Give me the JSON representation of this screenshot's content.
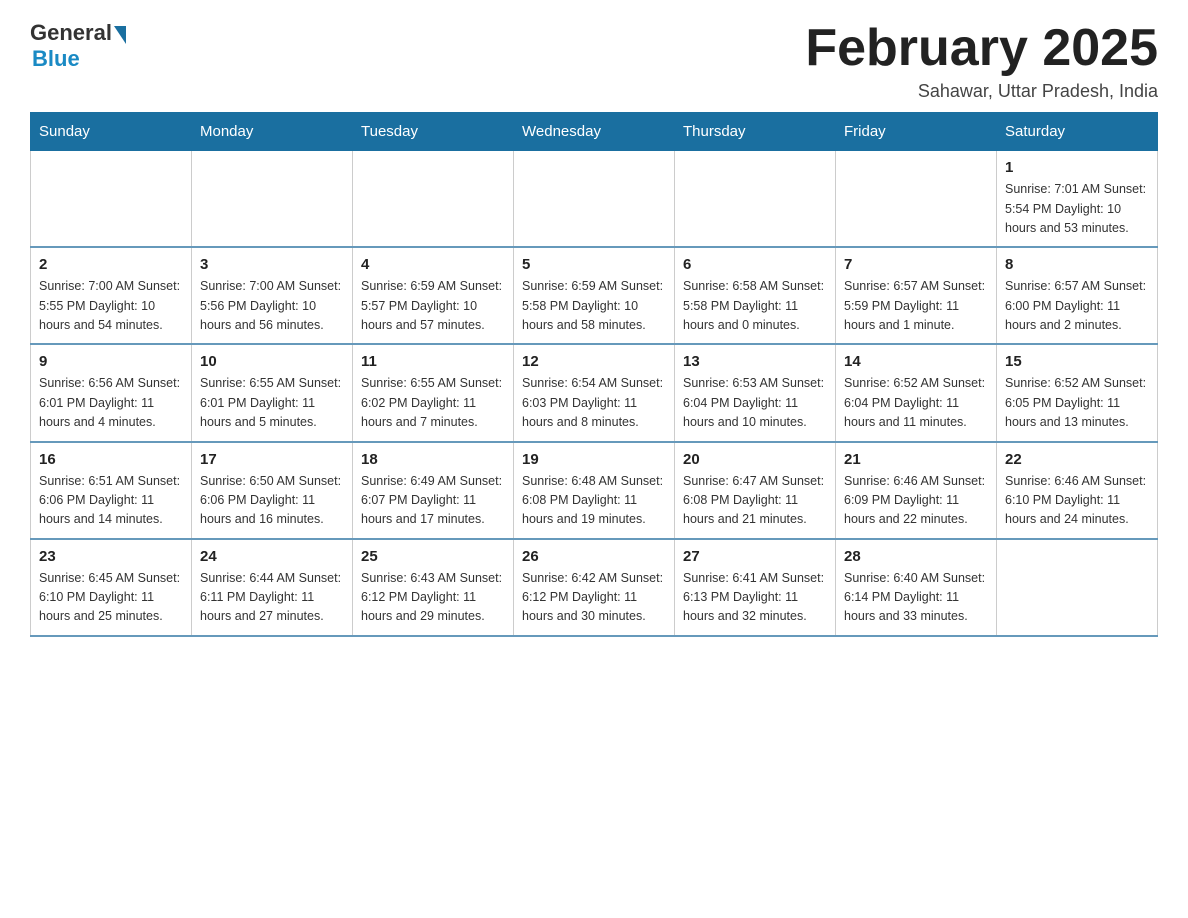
{
  "header": {
    "logo_general": "General",
    "logo_blue": "Blue",
    "month_title": "February 2025",
    "location": "Sahawar, Uttar Pradesh, India"
  },
  "days_of_week": [
    "Sunday",
    "Monday",
    "Tuesday",
    "Wednesday",
    "Thursday",
    "Friday",
    "Saturday"
  ],
  "weeks": [
    [
      {
        "day": "",
        "info": ""
      },
      {
        "day": "",
        "info": ""
      },
      {
        "day": "",
        "info": ""
      },
      {
        "day": "",
        "info": ""
      },
      {
        "day": "",
        "info": ""
      },
      {
        "day": "",
        "info": ""
      },
      {
        "day": "1",
        "info": "Sunrise: 7:01 AM\nSunset: 5:54 PM\nDaylight: 10 hours and 53 minutes."
      }
    ],
    [
      {
        "day": "2",
        "info": "Sunrise: 7:00 AM\nSunset: 5:55 PM\nDaylight: 10 hours and 54 minutes."
      },
      {
        "day": "3",
        "info": "Sunrise: 7:00 AM\nSunset: 5:56 PM\nDaylight: 10 hours and 56 minutes."
      },
      {
        "day": "4",
        "info": "Sunrise: 6:59 AM\nSunset: 5:57 PM\nDaylight: 10 hours and 57 minutes."
      },
      {
        "day": "5",
        "info": "Sunrise: 6:59 AM\nSunset: 5:58 PM\nDaylight: 10 hours and 58 minutes."
      },
      {
        "day": "6",
        "info": "Sunrise: 6:58 AM\nSunset: 5:58 PM\nDaylight: 11 hours and 0 minutes."
      },
      {
        "day": "7",
        "info": "Sunrise: 6:57 AM\nSunset: 5:59 PM\nDaylight: 11 hours and 1 minute."
      },
      {
        "day": "8",
        "info": "Sunrise: 6:57 AM\nSunset: 6:00 PM\nDaylight: 11 hours and 2 minutes."
      }
    ],
    [
      {
        "day": "9",
        "info": "Sunrise: 6:56 AM\nSunset: 6:01 PM\nDaylight: 11 hours and 4 minutes."
      },
      {
        "day": "10",
        "info": "Sunrise: 6:55 AM\nSunset: 6:01 PM\nDaylight: 11 hours and 5 minutes."
      },
      {
        "day": "11",
        "info": "Sunrise: 6:55 AM\nSunset: 6:02 PM\nDaylight: 11 hours and 7 minutes."
      },
      {
        "day": "12",
        "info": "Sunrise: 6:54 AM\nSunset: 6:03 PM\nDaylight: 11 hours and 8 minutes."
      },
      {
        "day": "13",
        "info": "Sunrise: 6:53 AM\nSunset: 6:04 PM\nDaylight: 11 hours and 10 minutes."
      },
      {
        "day": "14",
        "info": "Sunrise: 6:52 AM\nSunset: 6:04 PM\nDaylight: 11 hours and 11 minutes."
      },
      {
        "day": "15",
        "info": "Sunrise: 6:52 AM\nSunset: 6:05 PM\nDaylight: 11 hours and 13 minutes."
      }
    ],
    [
      {
        "day": "16",
        "info": "Sunrise: 6:51 AM\nSunset: 6:06 PM\nDaylight: 11 hours and 14 minutes."
      },
      {
        "day": "17",
        "info": "Sunrise: 6:50 AM\nSunset: 6:06 PM\nDaylight: 11 hours and 16 minutes."
      },
      {
        "day": "18",
        "info": "Sunrise: 6:49 AM\nSunset: 6:07 PM\nDaylight: 11 hours and 17 minutes."
      },
      {
        "day": "19",
        "info": "Sunrise: 6:48 AM\nSunset: 6:08 PM\nDaylight: 11 hours and 19 minutes."
      },
      {
        "day": "20",
        "info": "Sunrise: 6:47 AM\nSunset: 6:08 PM\nDaylight: 11 hours and 21 minutes."
      },
      {
        "day": "21",
        "info": "Sunrise: 6:46 AM\nSunset: 6:09 PM\nDaylight: 11 hours and 22 minutes."
      },
      {
        "day": "22",
        "info": "Sunrise: 6:46 AM\nSunset: 6:10 PM\nDaylight: 11 hours and 24 minutes."
      }
    ],
    [
      {
        "day": "23",
        "info": "Sunrise: 6:45 AM\nSunset: 6:10 PM\nDaylight: 11 hours and 25 minutes."
      },
      {
        "day": "24",
        "info": "Sunrise: 6:44 AM\nSunset: 6:11 PM\nDaylight: 11 hours and 27 minutes."
      },
      {
        "day": "25",
        "info": "Sunrise: 6:43 AM\nSunset: 6:12 PM\nDaylight: 11 hours and 29 minutes."
      },
      {
        "day": "26",
        "info": "Sunrise: 6:42 AM\nSunset: 6:12 PM\nDaylight: 11 hours and 30 minutes."
      },
      {
        "day": "27",
        "info": "Sunrise: 6:41 AM\nSunset: 6:13 PM\nDaylight: 11 hours and 32 minutes."
      },
      {
        "day": "28",
        "info": "Sunrise: 6:40 AM\nSunset: 6:14 PM\nDaylight: 11 hours and 33 minutes."
      },
      {
        "day": "",
        "info": ""
      }
    ]
  ]
}
